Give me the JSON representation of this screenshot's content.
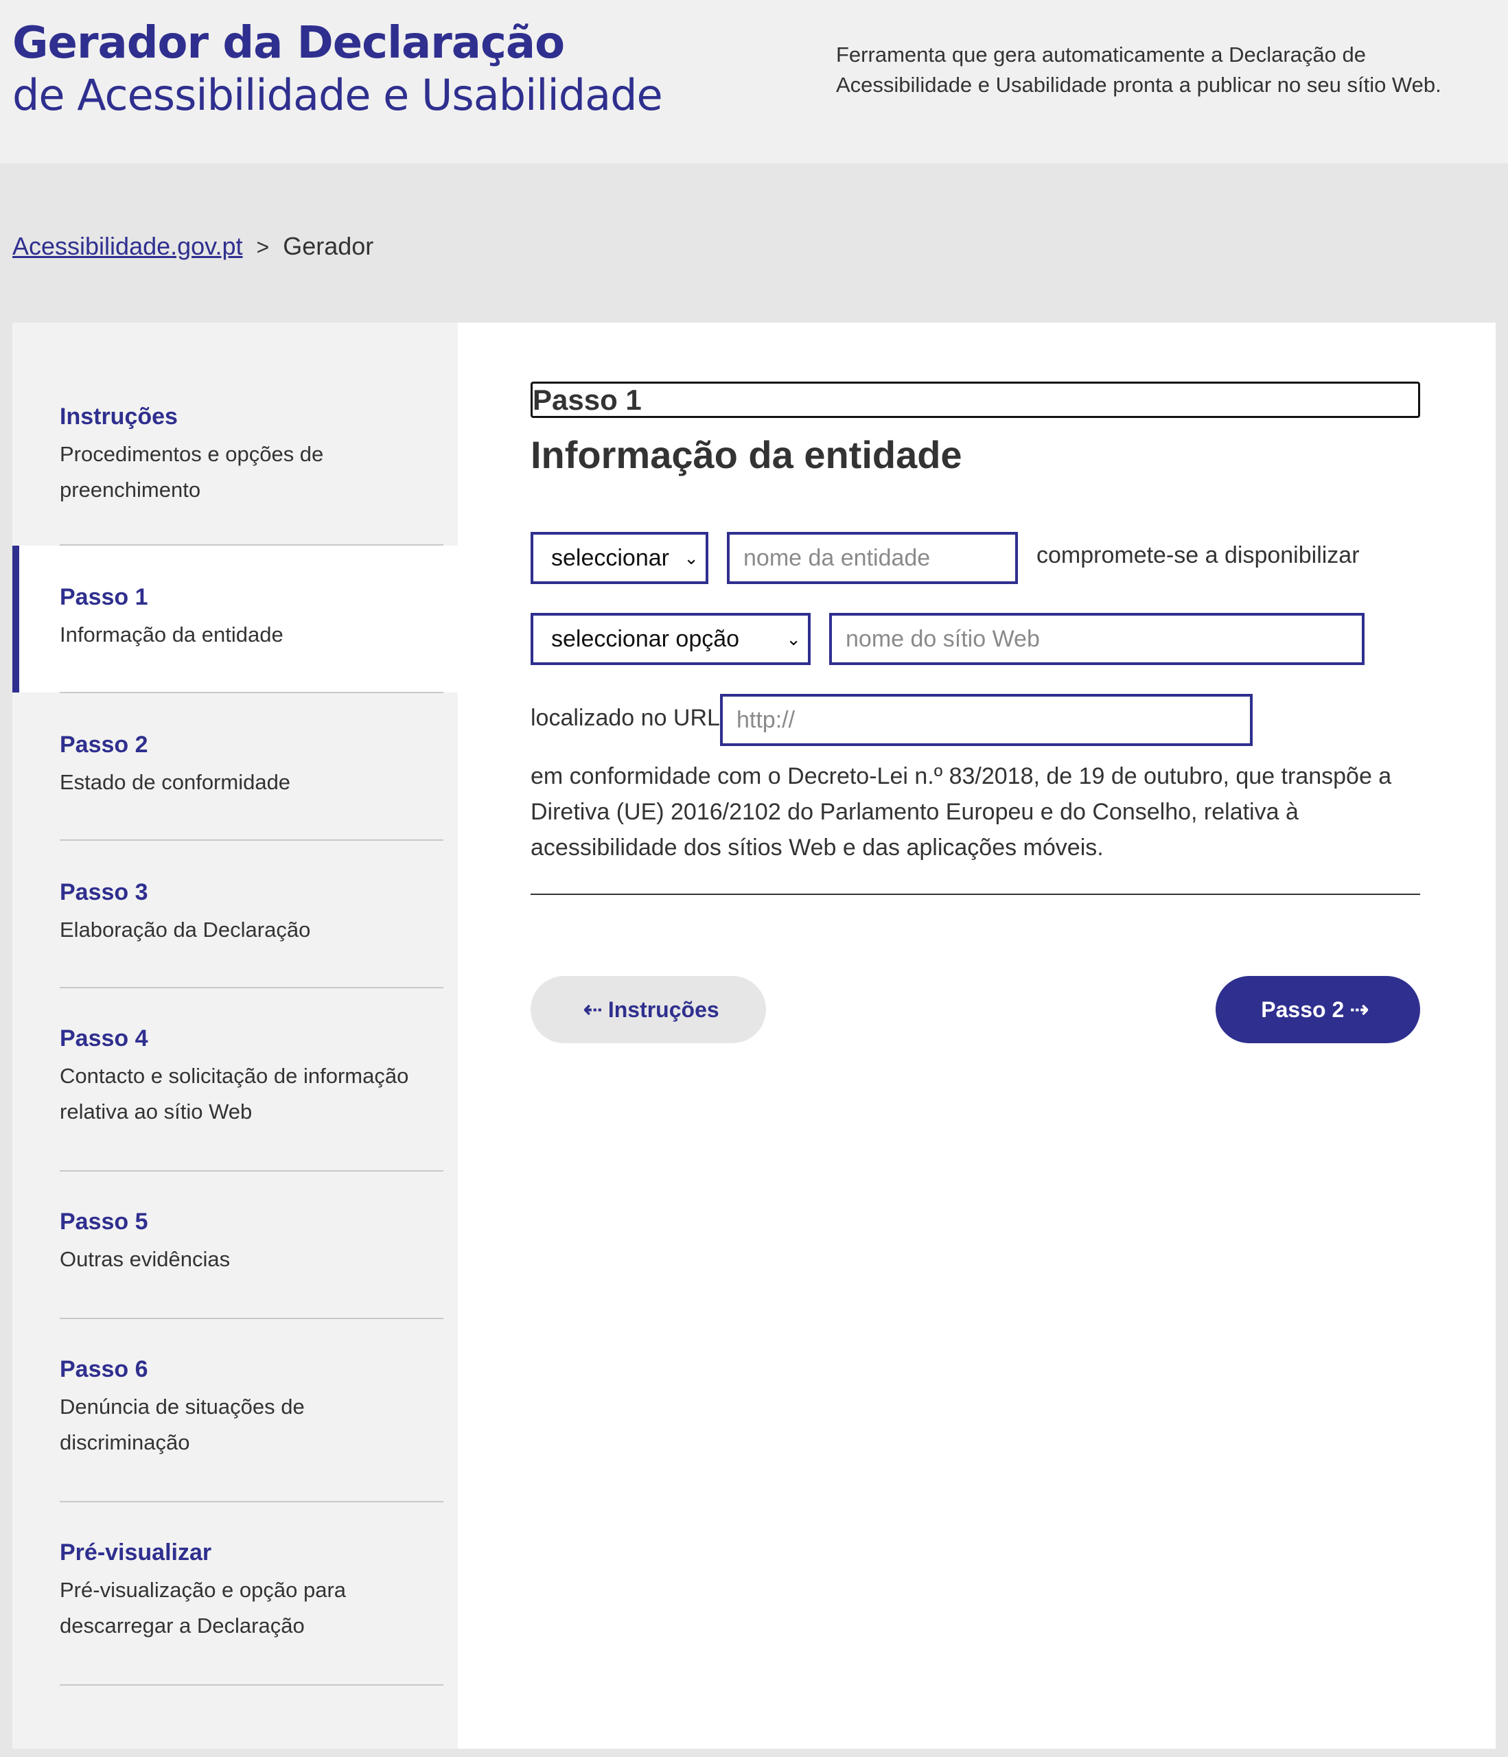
{
  "header": {
    "title_line1": "Gerador da Declaração",
    "title_line2": "de Acessibilidade e Usabilidade",
    "tagline": "Ferramenta que gera automaticamente a Declaração de Acessibilidade e Usabilidade pronta a publicar no seu sítio Web."
  },
  "breadcrumb": {
    "home": "Acessibilidade.gov.pt",
    "separator": ">",
    "current": "Gerador"
  },
  "sidebar": {
    "items": [
      {
        "title": "Instruções",
        "desc": "Procedimentos e opções de preenchimento"
      },
      {
        "title": "Passo 1",
        "desc": "Informação da entidade"
      },
      {
        "title": "Passo 2",
        "desc": "Estado de conformidade"
      },
      {
        "title": "Passo 3",
        "desc": "Elaboração da Declaração"
      },
      {
        "title": "Passo 4",
        "desc": "Contacto e solicitação de informação relativa ao sítio Web"
      },
      {
        "title": "Passo 5",
        "desc": "Outras evidências"
      },
      {
        "title": "Passo 6",
        "desc": "Denúncia de situações de discriminação"
      },
      {
        "title": "Pré-visualizar",
        "desc": "Pré-visualização e opção para descarregar a Declaração"
      }
    ]
  },
  "main": {
    "step_label": "Passo 1",
    "section_title": "Informação da entidade",
    "entity_type_select": "seleccionar",
    "entity_name_placeholder": "nome da entidade",
    "commits_text": "compromete-se a disponibilizar",
    "option_select": "seleccionar opção",
    "site_name_placeholder": "nome do sítio Web",
    "located_label": "localizado no URL",
    "url_placeholder": "http://",
    "compliance_text": "em conformidade com o Decreto-Lei n.º 83/2018, de 19 de outubro, que transpõe a Diretiva (UE) 2016/2102 do Parlamento Europeu e do Conselho, relativa à acessibilidade dos sítios Web e das aplicações móveis.",
    "back_button": "Instruções",
    "next_button": "Passo 2"
  },
  "colors": {
    "brand": "#2f2f8f",
    "header_bg": "#f0f0f0",
    "page_bg": "#e6e6e6"
  }
}
